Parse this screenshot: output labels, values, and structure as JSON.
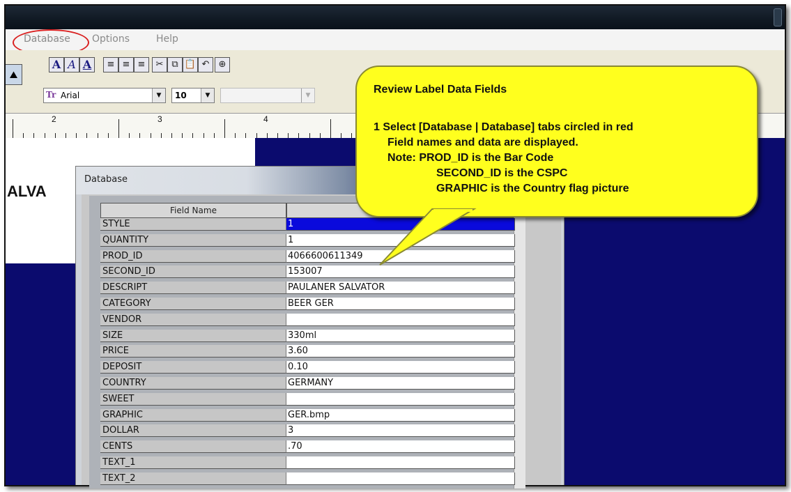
{
  "menu": {
    "database": "Database",
    "options": "Options",
    "help": "Help"
  },
  "toolbar": {
    "font_a_bold": "A",
    "font_a_italic": "A",
    "font_a_under": "A",
    "font_name": "Arial",
    "font_size": "10"
  },
  "ruler": {
    "n2": "2",
    "n3": "3",
    "n4": "4"
  },
  "canvas": {
    "fragment": "ALVA"
  },
  "dialog": {
    "title": "Database",
    "header_field": "Field Name",
    "rows": [
      {
        "name": "STYLE",
        "value": "1"
      },
      {
        "name": "QUANTITY",
        "value": "1"
      },
      {
        "name": "PROD_ID",
        "value": "4066600611349"
      },
      {
        "name": "SECOND_ID",
        "value": "153007"
      },
      {
        "name": "DESCRIPT",
        "value": "PAULANER SALVATOR"
      },
      {
        "name": "CATEGORY",
        "value": "BEER GER"
      },
      {
        "name": "VENDOR",
        "value": ""
      },
      {
        "name": "SIZE",
        "value": "330ml"
      },
      {
        "name": "PRICE",
        "value": "3.60"
      },
      {
        "name": "DEPOSIT",
        "value": "0.10"
      },
      {
        "name": "COUNTRY",
        "value": "GERMANY"
      },
      {
        "name": "SWEET",
        "value": ""
      },
      {
        "name": "GRAPHIC",
        "value": "GER.bmp"
      },
      {
        "name": "DOLLAR",
        "value": "3"
      },
      {
        "name": "CENTS",
        "value": ".70"
      },
      {
        "name": "TEXT_1",
        "value": ""
      },
      {
        "name": "TEXT_2",
        "value": ""
      }
    ]
  },
  "callout": {
    "title": "Review Label Data Fields",
    "line1": "1 Select [Database | Database] tabs circled in red",
    "line2": "Field names and data are displayed.",
    "line3": "Note: PROD_ID is the Bar Code",
    "line4": "SECOND_ID is the CSPC",
    "line5": "GRAPHIC is the Country flag picture"
  },
  "colors": {
    "selection": "#0a0adc",
    "canvas": "#0b0b6e",
    "callout": "#ffff1e",
    "highlight_ring": "#d92020"
  }
}
